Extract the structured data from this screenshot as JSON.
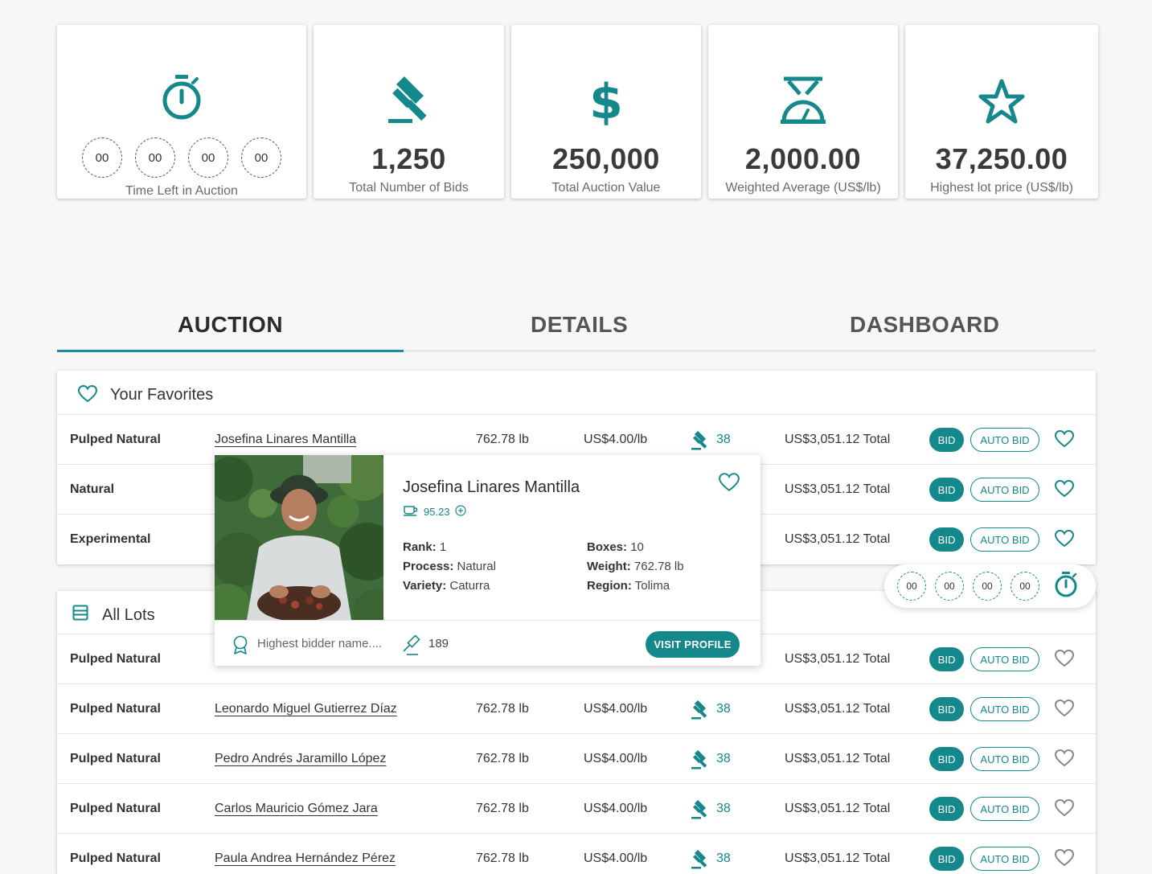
{
  "stats": {
    "timer": {
      "segments": [
        "00",
        "00",
        "00",
        "00"
      ],
      "label": "Time Left in Auction"
    },
    "bids": {
      "value": "1,250",
      "label": "Total Number of Bids"
    },
    "value": {
      "value": "250,000",
      "label": "Total Auction Value"
    },
    "avg": {
      "value": "2,000.00",
      "label": "Weighted Average (US$/lb)"
    },
    "highest": {
      "value": "37,250.00",
      "label": "Highest lot price (US$/lb)"
    }
  },
  "tabs": [
    "AUCTION",
    "DETAILS",
    "DASHBOARD"
  ],
  "favorites": {
    "title": "Your Favorites",
    "rows": [
      {
        "process": "Pulped Natural",
        "name": "Josefina Linares Mantilla",
        "weight": "762.78 lb",
        "price": "US$4.00/lb",
        "bids": "38",
        "total": "US$3,051.12 Total"
      },
      {
        "process": "Natural",
        "name": "",
        "weight": "",
        "price": "",
        "bids": "",
        "total": "US$3,051.12 Total"
      },
      {
        "process": "Experimental",
        "name": "",
        "weight": "",
        "price": "",
        "bids": "",
        "total": "US$3,051.12 Total"
      }
    ]
  },
  "all_lots": {
    "title": "All Lots",
    "rows": [
      {
        "process": "Pulped Natural",
        "name": "",
        "weight": "",
        "price": "",
        "bids": "",
        "total": "US$3,051.12 Total"
      },
      {
        "process": "Pulped Natural",
        "name": "Leonardo Miguel Gutierrez Díaz",
        "weight": "762.78 lb",
        "price": "US$4.00/lb",
        "bids": "38",
        "total": "US$3,051.12 Total"
      },
      {
        "process": "Pulped Natural",
        "name": "Pedro Andrés Jaramillo López",
        "weight": "762.78 lb",
        "price": "US$4.00/lb",
        "bids": "38",
        "total": "US$3,051.12 Total"
      },
      {
        "process": "Pulped Natural",
        "name": "Carlos Mauricio Gómez Jara",
        "weight": "762.78 lb",
        "price": "US$4.00/lb",
        "bids": "38",
        "total": "US$3,051.12 Total"
      },
      {
        "process": "Pulped Natural",
        "name": "Paula Andrea Hernández Pérez",
        "weight": "762.78 lb",
        "price": "US$4.00/lb",
        "bids": "38",
        "total": "US$3,051.12 Total"
      }
    ]
  },
  "buttons": {
    "bid": "BID",
    "auto_bid": "AUTO BID"
  },
  "float_timer": [
    "00",
    "00",
    "00",
    "00"
  ],
  "popup": {
    "name": "Josefina Linares Mantilla",
    "score": "95.23",
    "left": [
      {
        "k": "Rank:",
        "v": " 1"
      },
      {
        "k": "Process:",
        "v": " Natural"
      },
      {
        "k": "Variety:",
        "v": " Caturra"
      }
    ],
    "right": [
      {
        "k": "Boxes:",
        "v": " 10"
      },
      {
        "k": "Weight:",
        "v": " 762.78 lb"
      },
      {
        "k": "Region:",
        "v": " Tolima"
      }
    ],
    "bidder": "Highest bidder name....",
    "bid_count": "189",
    "visit": "VISIT PROFILE"
  },
  "colors": {
    "accent": "#14888a",
    "tab_underline": "#1f8aa6"
  }
}
